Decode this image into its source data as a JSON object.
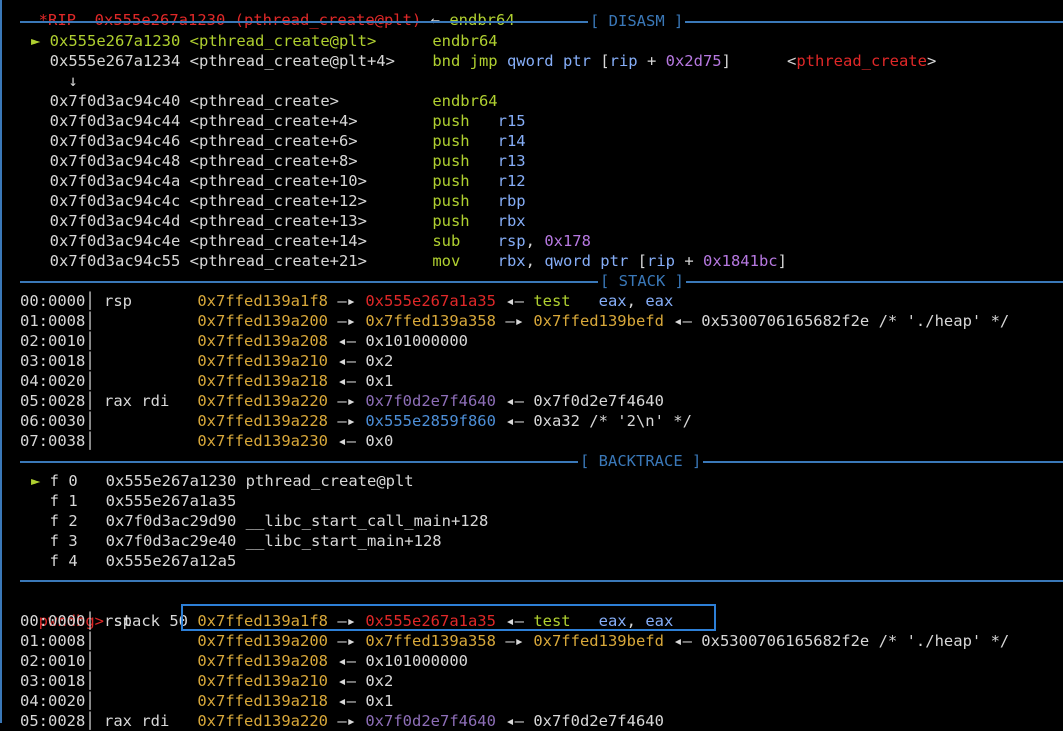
{
  "top_cut": {
    "reg": "*RIP",
    "addr": "0x555e267a1230",
    "sym": "(pthread_create@plt)",
    "arrow": "←",
    "instr": "endbr64"
  },
  "sections": {
    "disasm": "[ DISASM ]",
    "stack": "[ STACK ]",
    "backtrace": "[ BACKTRACE ]"
  },
  "disasm": {
    "marker": "►",
    "down_arrow": "↓",
    "lines": [
      {
        "addr": "0x555e267a1230",
        "sym": "<pthread_create@plt>",
        "mnem": "endbr64",
        "ops": []
      },
      {
        "addr": "0x555e267a1234",
        "sym": "<pthread_create@plt+4>",
        "mnem": "bnd jmp",
        "ops": [
          {
            "t": "qword ptr [",
            "c": "blue"
          },
          {
            "t": "rip",
            "c": "blue"
          },
          {
            "t": " + ",
            "c": "white"
          },
          {
            "t": "0x2d75",
            "c": "purple"
          },
          {
            "t": "]",
            "c": "white"
          }
        ],
        "target_open": "<",
        "target": "pthread_create",
        "target_close": ">"
      },
      {
        "addr": "0x7f0d3ac94c40",
        "sym": "<pthread_create>",
        "mnem": "endbr64"
      },
      {
        "addr": "0x7f0d3ac94c44",
        "sym": "<pthread_create+4>",
        "mnem": "push",
        "op": "r15"
      },
      {
        "addr": "0x7f0d3ac94c46",
        "sym": "<pthread_create+6>",
        "mnem": "push",
        "op": "r14"
      },
      {
        "addr": "0x7f0d3ac94c48",
        "sym": "<pthread_create+8>",
        "mnem": "push",
        "op": "r13"
      },
      {
        "addr": "0x7f0d3ac94c4a",
        "sym": "<pthread_create+10>",
        "mnem": "push",
        "op": "r12"
      },
      {
        "addr": "0x7f0d3ac94c4c",
        "sym": "<pthread_create+12>",
        "mnem": "push",
        "op": "rbp"
      },
      {
        "addr": "0x7f0d3ac94c4d",
        "sym": "<pthread_create+13>",
        "mnem": "push",
        "op": "rbx"
      },
      {
        "addr": "0x7f0d3ac94c4e",
        "sym": "<pthread_create+14>",
        "mnem": "sub",
        "op": "rsp",
        "op2": "0x178"
      },
      {
        "addr": "0x7f0d3ac94c55",
        "sym": "<pthread_create+21>",
        "mnem": "mov",
        "op": "rbx",
        "op2": "qword ptr [rip + 0x1841bc]"
      }
    ]
  },
  "stack": [
    {
      "idx": "00:0000",
      "reg": "rsp",
      "addr": "0x7ffed139a1f8",
      "v1": "0x555e267a1a35",
      "v1c": "red",
      "v2": "test   eax, eax",
      "v2c": "green_mixed"
    },
    {
      "idx": "01:0008",
      "reg": "",
      "addr": "0x7ffed139a200",
      "v1": "0x7ffed139a358",
      "v1c": "yellow",
      "v2": "0x7ffed139befd",
      "v2c": "yellow",
      "v3": "0x5300706165682f2e /* './heap' */"
    },
    {
      "idx": "02:0010",
      "reg": "",
      "addr": "0x7ffed139a208",
      "v1": "0x101000000",
      "v1c": "white"
    },
    {
      "idx": "03:0018",
      "reg": "",
      "addr": "0x7ffed139a210",
      "v1": "0x2",
      "v1c": "white"
    },
    {
      "idx": "04:0020",
      "reg": "",
      "addr": "0x7ffed139a218",
      "v1": "0x1",
      "v1c": "white"
    },
    {
      "idx": "05:0028",
      "reg": "rax rdi",
      "addr": "0x7ffed139a220",
      "v1": "0x7f0d2e7f4640",
      "v1c": "violet",
      "v2": "0x7f0d2e7f4640",
      "v2c": "white"
    },
    {
      "idx": "06:0030",
      "reg": "",
      "addr": "0x7ffed139a228",
      "v1": "0x555e2859f860",
      "v1c": "dblue",
      "v2": "0xa32 /* '2\\n' */",
      "v2c": "white"
    },
    {
      "idx": "07:0038",
      "reg": "",
      "addr": "0x7ffed139a230",
      "v1": "0x0",
      "v1c": "white"
    }
  ],
  "backtrace": [
    {
      "marker": "►",
      "frame": "f 0",
      "addr": "0x555e267a1230",
      "sym": "pthread_create@plt"
    },
    {
      "marker": "",
      "frame": "f 1",
      "addr": "0x555e267a1a35",
      "sym": ""
    },
    {
      "marker": "",
      "frame": "f 2",
      "addr": "0x7f0d3ac29d90",
      "sym": "__libc_start_call_main+128"
    },
    {
      "marker": "",
      "frame": "f 3",
      "addr": "0x7f0d3ac29e40",
      "sym": "__libc_start_main+128"
    },
    {
      "marker": "",
      "frame": "f 4",
      "addr": "0x555e267a12a5",
      "sym": ""
    }
  ],
  "prompt": {
    "name": "pwndbg>",
    "command": "stack 50"
  },
  "stack2": [
    {
      "idx": "00:0000",
      "reg": "rsp",
      "addr": "0x7ffed139a1f8",
      "v1": "0x555e267a1a35",
      "v1c": "red",
      "v2": "test   eax, eax",
      "v2c": "green_mixed"
    },
    {
      "idx": "01:0008",
      "reg": "",
      "addr": "0x7ffed139a200",
      "v1": "0x7ffed139a358",
      "v1c": "yellow",
      "v2": "0x7ffed139befd",
      "v2c": "yellow",
      "v3": "0x5300706165682f2e /* './heap' */"
    },
    {
      "idx": "02:0010",
      "reg": "",
      "addr": "0x7ffed139a208",
      "v1": "0x101000000",
      "v1c": "white"
    },
    {
      "idx": "03:0018",
      "reg": "",
      "addr": "0x7ffed139a210",
      "v1": "0x2",
      "v1c": "white"
    },
    {
      "idx": "04:0020",
      "reg": "",
      "addr": "0x7ffed139a218",
      "v1": "0x1",
      "v1c": "white"
    },
    {
      "idx": "05:0028",
      "reg": "rax rdi",
      "addr": "0x7ffed139a220",
      "v1": "0x7f0d2e7f4640",
      "v1c": "violet",
      "v2": "0x7f0d2e7f4640",
      "v2c": "white"
    }
  ],
  "arrows": {
    "right": "—▸",
    "left": "◂—"
  },
  "colors": {
    "background": "#000000",
    "separator": "#3a78b8",
    "highlight_box": "#2d7fd6",
    "green": "#b0d030",
    "yellow": "#d8a83a",
    "red": "#e02828",
    "blue": "#86aef8",
    "purple": "#b678e0"
  }
}
